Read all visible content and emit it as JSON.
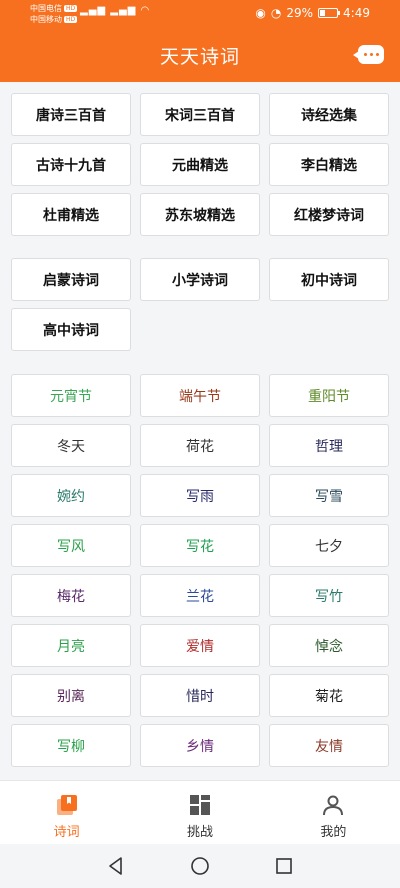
{
  "status": {
    "carrier1": "中国电信",
    "carrier2": "中国移动",
    "hd": "HD",
    "battery_text": "29%",
    "battery_level": 0.29,
    "time": "4:49"
  },
  "header": {
    "title": "天天诗词"
  },
  "collections": [
    "唐诗三百首",
    "宋词三百首",
    "诗经选集",
    "古诗十九首",
    "元曲精选",
    "李白精选",
    "杜甫精选",
    "苏东坡精选",
    "红楼梦诗词"
  ],
  "school": [
    "启蒙诗词",
    "小学诗词",
    "初中诗词",
    "高中诗词"
  ],
  "topics": [
    {
      "label": "元宵节",
      "color": "#3aa655"
    },
    {
      "label": "端午节",
      "color": "#9a3b1b"
    },
    {
      "label": "重阳节",
      "color": "#5f8b2a"
    },
    {
      "label": "冬天",
      "color": "#333333"
    },
    {
      "label": "荷花",
      "color": "#333333"
    },
    {
      "label": "哲理",
      "color": "#2a2a5a"
    },
    {
      "label": "婉约",
      "color": "#2a7a6a"
    },
    {
      "label": "写雨",
      "color": "#2a2a6a"
    },
    {
      "label": "写雪",
      "color": "#2a4a5a"
    },
    {
      "label": "写风",
      "color": "#2aa24a"
    },
    {
      "label": "写花",
      "color": "#1fa050"
    },
    {
      "label": "七夕",
      "color": "#333333"
    },
    {
      "label": "梅花",
      "color": "#5a2a6a"
    },
    {
      "label": "兰花",
      "color": "#2a4a9a"
    },
    {
      "label": "写竹",
      "color": "#2a7a6a"
    },
    {
      "label": "月亮",
      "color": "#2aa24a"
    },
    {
      "label": "爱情",
      "color": "#b02a2a"
    },
    {
      "label": "悼念",
      "color": "#2a5a2a"
    },
    {
      "label": "别离",
      "color": "#5a2a5a"
    },
    {
      "label": "惜时",
      "color": "#2a2a5a"
    },
    {
      "label": "菊花",
      "color": "#222222"
    },
    {
      "label": "写柳",
      "color": "#2aa24a"
    },
    {
      "label": "乡情",
      "color": "#6a2a7a"
    },
    {
      "label": "友情",
      "color": "#8a3a2a"
    }
  ],
  "tabs": [
    {
      "label": "诗词",
      "icon": "book-icon",
      "active": true
    },
    {
      "label": "挑战",
      "icon": "grid-icon",
      "active": false
    },
    {
      "label": "我的",
      "icon": "person-icon",
      "active": false
    }
  ],
  "colors": {
    "accent": "#f7701f"
  }
}
